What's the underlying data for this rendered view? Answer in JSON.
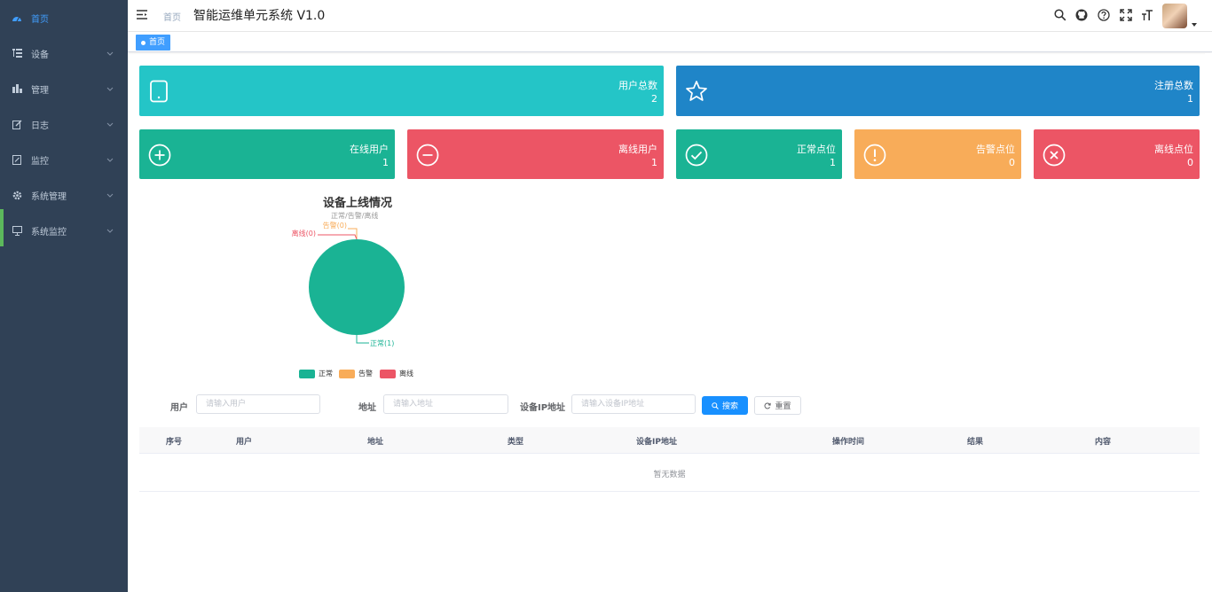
{
  "sidebar": {
    "items": [
      {
        "label": "首页",
        "icon": "dashboard-icon",
        "active": true,
        "has_children": false
      },
      {
        "label": "设备",
        "icon": "list-tree-icon",
        "active": false,
        "has_children": true
      },
      {
        "label": "管理",
        "icon": "bar-chart-icon",
        "active": false,
        "has_children": true
      },
      {
        "label": "日志",
        "icon": "edit-icon",
        "active": false,
        "has_children": true
      },
      {
        "label": "监控",
        "icon": "edit-doc-icon",
        "active": false,
        "has_children": true
      },
      {
        "label": "系统管理",
        "icon": "gear-icon",
        "active": false,
        "has_children": true
      },
      {
        "label": "系统监控",
        "icon": "monitor-icon",
        "active": false,
        "has_children": true
      }
    ],
    "colors": {
      "bg": "#304156",
      "text": "#bfcbd9",
      "active": "#409eff"
    }
  },
  "header": {
    "breadcrumb": "首页",
    "title": "智能运维单元系统 V1.0",
    "icons": [
      "search-icon",
      "github-icon",
      "help-icon",
      "fullscreen-icon",
      "font-size-icon"
    ]
  },
  "tags": {
    "active": "首页"
  },
  "cards": {
    "users_total": {
      "label": "用户总数",
      "value": "2",
      "color": "#24c5c7"
    },
    "registered_total": {
      "label": "注册总数",
      "value": "1",
      "color": "#1f85c8"
    },
    "online_users": {
      "label": "在线用户",
      "value": "1",
      "color": "#1ab394"
    },
    "offline_users": {
      "label": "离线用户",
      "value": "1",
      "color": "#ec5565"
    },
    "normal_points": {
      "label": "正常点位",
      "value": "1",
      "color": "#1ab394"
    },
    "alarm_points": {
      "label": "告警点位",
      "value": "0",
      "color": "#f8ac59"
    },
    "offline_points": {
      "label": "离线点位",
      "value": "0",
      "color": "#ec5565"
    }
  },
  "chart_data": {
    "type": "pie",
    "title": "设备上线情况",
    "subtitle": "正常/告警/离线",
    "slices": [
      {
        "name": "正常",
        "value": 1,
        "label": "正常(1)",
        "color": "#1ab394"
      },
      {
        "name": "告警",
        "value": 0,
        "label": "告警(0)",
        "color": "#f8ac59"
      },
      {
        "name": "离线",
        "value": 0,
        "label": "离线(0)",
        "color": "#ec5565"
      }
    ],
    "legend": [
      "正常",
      "告警",
      "离线"
    ],
    "legend_position": "bottom"
  },
  "search": {
    "user_label": "用户",
    "user_placeholder": "请输入用户",
    "address_label": "地址",
    "address_placeholder": "请输入地址",
    "ip_label": "设备IP地址",
    "ip_placeholder": "请输入设备IP地址",
    "search_button": "搜索",
    "reset_button": "重置"
  },
  "table": {
    "columns": [
      "序号",
      "用户",
      "地址",
      "类型",
      "设备IP地址",
      "操作时间",
      "结果",
      "内容"
    ],
    "empty_text": "暂无数据"
  }
}
